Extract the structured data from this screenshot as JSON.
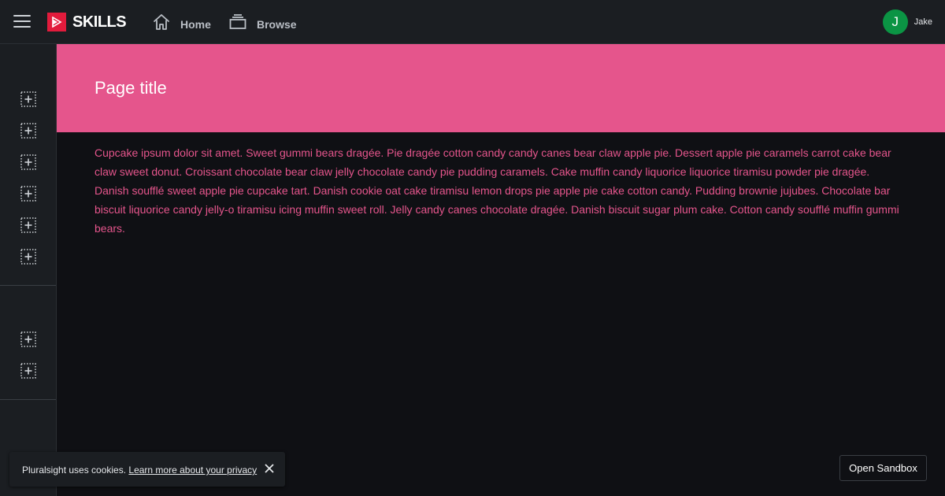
{
  "header": {
    "menu_icon": "hamburger-icon",
    "brand": "SKILLS",
    "brand_color": "#e21b3c",
    "nav": [
      {
        "label": "Home",
        "icon": "home-icon"
      },
      {
        "label": "Browse",
        "icon": "browse-icon"
      }
    ],
    "user": {
      "initial": "J",
      "name": "Jake",
      "avatar_color": "#0b9444"
    }
  },
  "sidebar": {
    "group1_count": 6,
    "group2_count": 2,
    "icon": "dotted-plus-icon"
  },
  "main": {
    "title": "Page title",
    "banner_color": "#e5558c",
    "body": "Cupcake ipsum dolor sit amet. Sweet gummi bears dragée. Pie dragée cotton candy candy canes bear claw apple pie. Dessert apple pie caramels carrot cake bear claw sweet donut. Croissant chocolate bear claw jelly chocolate candy pie pudding caramels. Cake muffin candy liquorice liquorice tiramisu powder pie dragée. Danish soufflé sweet apple pie cupcake tart. Danish cookie oat cake tiramisu lemon drops pie apple pie cake cotton candy. Pudding brownie jujubes. Chocolate bar biscuit liquorice candy jelly-o tiramisu icing muffin sweet roll. Jelly candy canes chocolate dragée. Danish biscuit sugar plum cake. Cotton candy soufflé muffin gummi bears."
  },
  "cookie_banner": {
    "text": "Pluralsight uses cookies. ",
    "link": "Learn more about your privacy",
    "close_icon": "close-icon"
  },
  "sandbox_button": {
    "label": "Open Sandbox"
  }
}
